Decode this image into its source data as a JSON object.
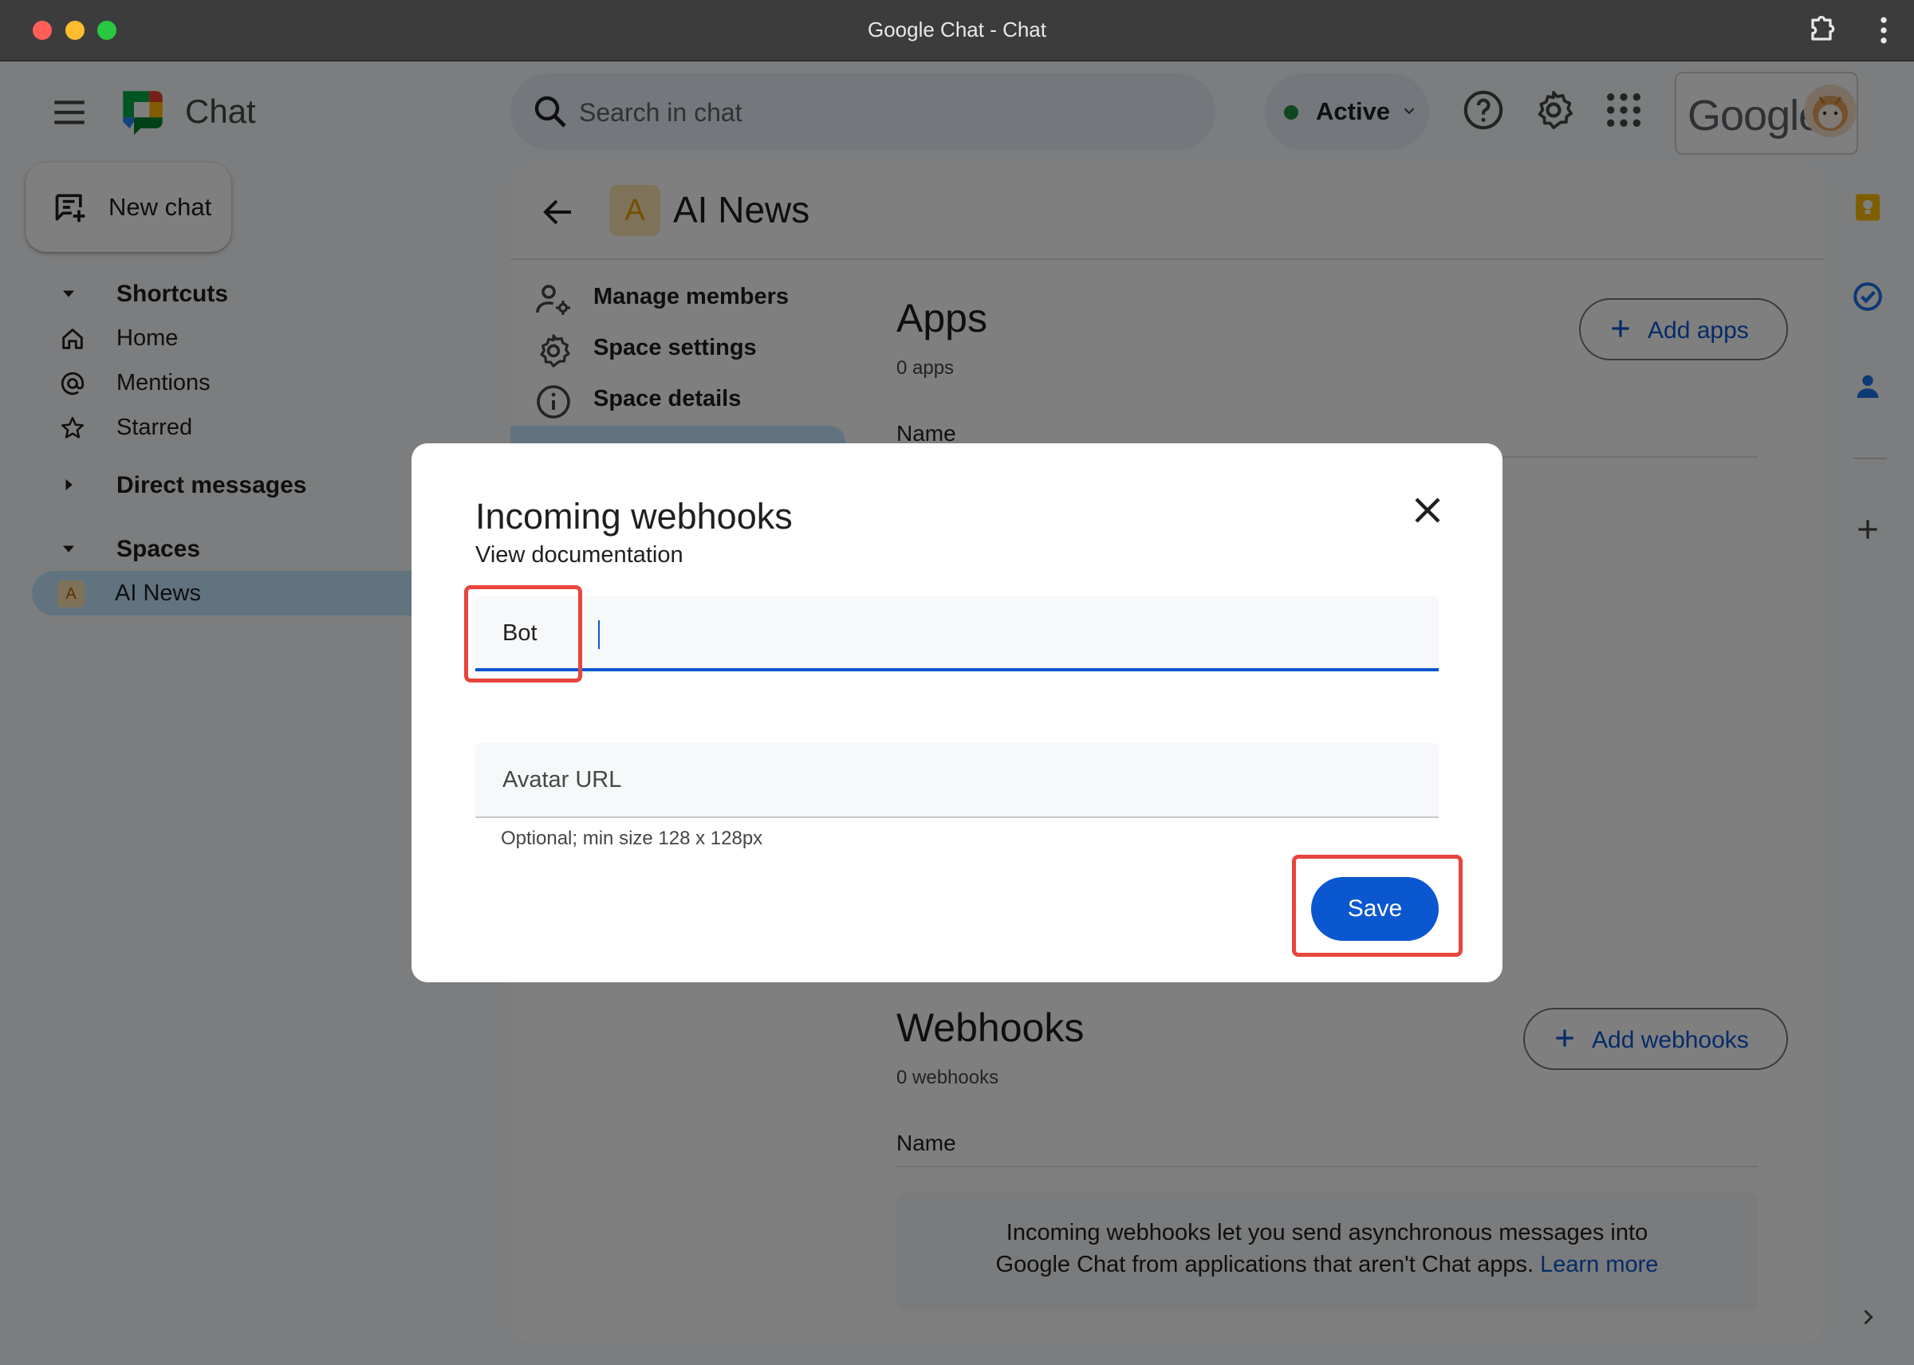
{
  "window": {
    "title": "Google Chat - Chat"
  },
  "header": {
    "app_name": "Chat",
    "search": {
      "placeholder": "Search in chat",
      "value": ""
    },
    "status": {
      "label": "Active",
      "color": "#1e8e3e"
    },
    "icons": [
      "menu-icon",
      "chat-logo-icon",
      "search-icon",
      "help-icon",
      "settings-gear-icon",
      "apps-grid-icon"
    ],
    "account": {
      "brand": "Google"
    }
  },
  "sidebar": {
    "new_chat": {
      "label": "New chat",
      "icon": "new-chat-icon"
    },
    "shortcuts": {
      "label": "Shortcuts"
    },
    "items": [
      {
        "label": "Home",
        "icon": "home-icon"
      },
      {
        "label": "Mentions",
        "icon": "at-sign-icon"
      },
      {
        "label": "Starred",
        "icon": "star-icon"
      }
    ],
    "direct_messages": {
      "label": "Direct messages"
    },
    "spaces": {
      "label": "Spaces"
    },
    "space_items": [
      {
        "initial": "A",
        "label": "AI News",
        "selected": true
      }
    ]
  },
  "main": {
    "space": {
      "initial": "A",
      "name": "AI News"
    },
    "sub_nav": [
      {
        "label": "Manage members",
        "icon": "manage-members-icon"
      },
      {
        "label": "Space settings",
        "icon": "settings-gear-icon"
      },
      {
        "label": "Space details",
        "icon": "info-icon"
      }
    ],
    "apps": {
      "title": "Apps",
      "count": "0 apps",
      "add_button": "Add apps",
      "column": "Name"
    },
    "webhooks": {
      "title": "Webhooks",
      "count": "0 webhooks",
      "add_button": "Add webhooks",
      "column": "Name",
      "info_text": "Incoming webhooks let you send asynchronous messages into Google Chat from applications that aren't Chat apps.",
      "learn_more": "Learn more"
    }
  },
  "right_rail": {
    "icons": [
      "keep-icon",
      "tasks-icon",
      "contacts-icon",
      "add-icon",
      "chevron-right-icon"
    ]
  },
  "dialog": {
    "title": "Incoming webhooks",
    "documentation_link": "View documentation",
    "name_field": {
      "value": "Bot",
      "placeholder": ""
    },
    "avatar_field": {
      "placeholder": "Avatar URL",
      "value": ""
    },
    "avatar_hint": "Optional; min size 128 x 128px",
    "save_label": "Save"
  },
  "colors": {
    "accent": "#0b57d0",
    "selected_bg": "#c2e7ff",
    "annotation": "#e8453c"
  }
}
